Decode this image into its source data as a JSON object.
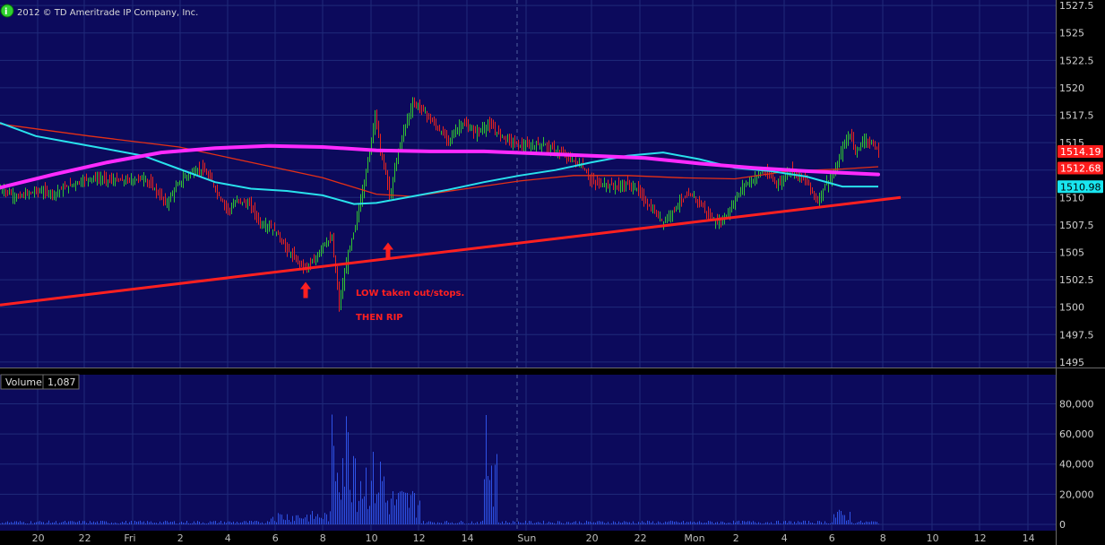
{
  "header": {
    "copyright": "2012 © TD Ameritrade IP Company, Inc.",
    "info_icon_label": "i"
  },
  "volume_panel": {
    "label": "Volume",
    "value": "1,087"
  },
  "annotations": [
    {
      "text": "LOW taken out/stops.",
      "name": "annotation-low-taken-out"
    },
    {
      "text": "THEN RIP",
      "name": "annotation-then-rip"
    }
  ],
  "price_badges": [
    {
      "value": "1514.19",
      "bg": "#ff1c1c",
      "fg": "#ffffff",
      "name": "badge-last-price"
    },
    {
      "value": "1512.68",
      "bg": "#ff1c1c",
      "fg": "#ffffff",
      "name": "badge-ma-red"
    },
    {
      "value": "1510.98",
      "bg": "#19e6f0",
      "fg": "#000000",
      "name": "badge-ma-cyan"
    }
  ],
  "colors": {
    "panel_bg": "#0c0a5c",
    "grid": "#1f2a7a",
    "candles_up": "#31c431",
    "candles_down": "#e8241e",
    "ma_magenta": "#ff2aff",
    "ma_cyan": "#29e1ec",
    "ma_red": "#e43016",
    "trendline": "#ff2020",
    "volume_bars": "#2f53e6"
  },
  "chart_data": {
    "type": "candlestick",
    "y_ticks": [
      "1527.5",
      "1525",
      "1522.5",
      "1520",
      "1517.5",
      "1515",
      "1512.5",
      "1510",
      "1507.5",
      "1505",
      "1502.5",
      "1500",
      "1497.5",
      "1495"
    ],
    "ylim": [
      1494.5,
      1528
    ],
    "volume_ticks": [
      "80,000",
      "60,000",
      "40,000",
      "20,000",
      "0"
    ],
    "volume_ylim": [
      0,
      88000
    ],
    "x_ticks": [
      "20",
      "22",
      "Fri",
      "2",
      "4",
      "6",
      "8",
      "10",
      "12",
      "14",
      "Sun",
      "20",
      "22",
      "Mon",
      "2",
      "4",
      "6",
      "8",
      "10",
      "12",
      "14"
    ],
    "price_path": [
      [
        0,
        1510.8
      ],
      [
        20,
        1510
      ],
      [
        40,
        1510.6
      ],
      [
        60,
        1510.4
      ],
      [
        80,
        1511.2
      ],
      [
        100,
        1511.8
      ],
      [
        120,
        1511.6
      ],
      [
        140,
        1511.5
      ],
      [
        160,
        1511.8
      ],
      [
        175,
        1510.5
      ],
      [
        185,
        1509.4
      ],
      [
        195,
        1510.8
      ],
      [
        205,
        1511.8
      ],
      [
        215,
        1512.4
      ],
      [
        225,
        1512.6
      ],
      [
        235,
        1511.6
      ],
      [
        245,
        1510
      ],
      [
        255,
        1508.8
      ],
      [
        265,
        1509.8
      ],
      [
        280,
        1509.2
      ],
      [
        290,
        1507.6
      ],
      [
        300,
        1507.4
      ],
      [
        310,
        1506.6
      ],
      [
        320,
        1505.2
      ],
      [
        330,
        1504.3
      ],
      [
        340,
        1503.6
      ],
      [
        350,
        1504.1
      ],
      [
        360,
        1505.8
      ],
      [
        370,
        1506.2
      ],
      [
        378,
        1500.2
      ],
      [
        388,
        1504.8
      ],
      [
        396,
        1507.4
      ],
      [
        404,
        1510.6
      ],
      [
        412,
        1514.2
      ],
      [
        418,
        1517.8
      ],
      [
        425,
        1513.8
      ],
      [
        430,
        1512.2
      ],
      [
        435,
        1509.8
      ],
      [
        442,
        1513.6
      ],
      [
        450,
        1516.1
      ],
      [
        460,
        1518.6
      ],
      [
        470,
        1518.1
      ],
      [
        485,
        1516.6
      ],
      [
        500,
        1515.2
      ],
      [
        515,
        1516.8
      ],
      [
        530,
        1515.9
      ],
      [
        545,
        1516.6
      ],
      [
        560,
        1515.6
      ],
      [
        575,
        1514.9
      ],
      [
        590,
        1514.6
      ],
      [
        605,
        1514.9
      ],
      [
        620,
        1514.2
      ],
      [
        635,
        1513.6
      ],
      [
        650,
        1512.8
      ],
      [
        660,
        1511.4
      ],
      [
        675,
        1511.2
      ],
      [
        690,
        1511
      ],
      [
        700,
        1511.2
      ],
      [
        710,
        1510.8
      ],
      [
        720,
        1509.6
      ],
      [
        730,
        1508.6
      ],
      [
        740,
        1507.8
      ],
      [
        750,
        1508.8
      ],
      [
        760,
        1509.8
      ],
      [
        770,
        1510.2
      ],
      [
        780,
        1509.6
      ],
      [
        790,
        1508.4
      ],
      [
        800,
        1507.6
      ],
      [
        810,
        1508.4
      ],
      [
        820,
        1509.8
      ],
      [
        830,
        1511.2
      ],
      [
        840,
        1511.6
      ],
      [
        850,
        1512.4
      ],
      [
        860,
        1511.8
      ],
      [
        870,
        1511.2
      ],
      [
        880,
        1512.6
      ],
      [
        890,
        1512
      ],
      [
        900,
        1511.4
      ],
      [
        912,
        1509.6
      ],
      [
        920,
        1511.2
      ],
      [
        930,
        1512
      ],
      [
        940,
        1514.6
      ],
      [
        948,
        1515.8
      ],
      [
        955,
        1514.2
      ],
      [
        965,
        1515.4
      ],
      [
        975,
        1514.6
      ],
      [
        981,
        1514.2
      ]
    ],
    "ma_magenta_path": [
      [
        0,
        1510.9
      ],
      [
        60,
        1512.1
      ],
      [
        120,
        1513.2
      ],
      [
        180,
        1514.1
      ],
      [
        240,
        1514.5
      ],
      [
        300,
        1514.7
      ],
      [
        360,
        1514.6
      ],
      [
        420,
        1514.3
      ],
      [
        480,
        1514.2
      ],
      [
        540,
        1514.2
      ],
      [
        600,
        1514
      ],
      [
        660,
        1513.8
      ],
      [
        720,
        1513.6
      ],
      [
        780,
        1513.1
      ],
      [
        840,
        1512.7
      ],
      [
        900,
        1512.4
      ],
      [
        980,
        1512.1
      ]
    ],
    "ma_cyan_path": [
      [
        0,
        1516.8
      ],
      [
        40,
        1515.6
      ],
      [
        80,
        1515.0
      ],
      [
        120,
        1514.4
      ],
      [
        160,
        1513.8
      ],
      [
        200,
        1512.6
      ],
      [
        240,
        1511.4
      ],
      [
        280,
        1510.8
      ],
      [
        320,
        1510.6
      ],
      [
        360,
        1510.2
      ],
      [
        395,
        1509.4
      ],
      [
        420,
        1509.5
      ],
      [
        460,
        1510.1
      ],
      [
        500,
        1510.7
      ],
      [
        540,
        1511.4
      ],
      [
        580,
        1512
      ],
      [
        620,
        1512.5
      ],
      [
        660,
        1513.2
      ],
      [
        700,
        1513.8
      ],
      [
        740,
        1514.1
      ],
      [
        780,
        1513.5
      ],
      [
        820,
        1512.7
      ],
      [
        860,
        1512.4
      ],
      [
        900,
        1511.9
      ],
      [
        940,
        1511.0
      ],
      [
        980,
        1511.0
      ]
    ],
    "ma_red_path": [
      [
        0,
        1516.7
      ],
      [
        100,
        1515.6
      ],
      [
        200,
        1514.6
      ],
      [
        280,
        1513.2
      ],
      [
        360,
        1511.8
      ],
      [
        420,
        1510.3
      ],
      [
        460,
        1510.1
      ],
      [
        520,
        1510.8
      ],
      [
        580,
        1511.5
      ],
      [
        640,
        1512
      ],
      [
        700,
        1512.0
      ],
      [
        760,
        1511.8
      ],
      [
        820,
        1511.7
      ],
      [
        880,
        1512.4
      ],
      [
        940,
        1512.6
      ],
      [
        980,
        1512.8
      ]
    ],
    "trendline": [
      [
        0,
        1500.2
      ],
      [
        1005,
        1510.0
      ]
    ],
    "annotation_arrows": [
      [
        341,
        1502.3
      ],
      [
        433,
        1505.9
      ]
    ],
    "volume_spike_zones": [
      {
        "x0": 370,
        "x1": 398,
        "vmax": 82000
      },
      {
        "x0": 398,
        "x1": 430,
        "vmax": 50000
      },
      {
        "x0": 430,
        "x1": 470,
        "vmax": 26000
      },
      {
        "x0": 540,
        "x1": 556,
        "vmax": 76000
      },
      {
        "x0": 300,
        "x1": 370,
        "vmax": 9000
      },
      {
        "x0": 930,
        "x1": 950,
        "vmax": 10000
      }
    ]
  }
}
